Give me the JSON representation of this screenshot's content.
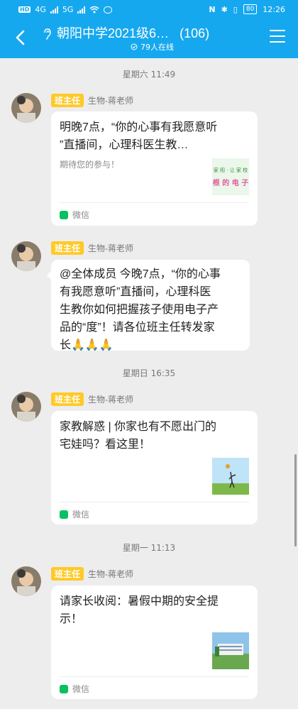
{
  "status_bar": {
    "network1": "4G",
    "network2": "5G",
    "battery": "80",
    "time": "12:26"
  },
  "header": {
    "title": "朝阳中学2021级6…",
    "member_count": "(106)",
    "online": "79人在线"
  },
  "messages": [
    {
      "timestamp": "星期六 11:49",
      "role": "班主任",
      "sender": "生物-蒋老师",
      "type": "card",
      "title_line1": "明晚7点，“你的心事有我愿意听",
      "title_line2": "”直播间，心理科医生教…",
      "desc": "期待您的参与！",
      "source": "微信",
      "thumb_text_top": "家 阳 · 让 家 校",
      "thumb_text_bottom": "根 的 电 子"
    },
    {
      "role": "班主任",
      "sender": "生物-蒋老师",
      "type": "text",
      "lines": [
        "@全体成员 今晚7点，“你的心事",
        "有我愿意听”直播间，心理科医",
        "生教你如何把握孩子使用电子产",
        "品的“度”！请各位班主任转发家",
        "长🙏🙏🙏"
      ]
    },
    {
      "timestamp": "星期日 16:35",
      "role": "班主任",
      "sender": "生物-蒋老师",
      "type": "card",
      "title_line1": "家教解惑 | 你家也有不愿出门的",
      "title_line2": "宅娃吗？看这里！",
      "source": "微信"
    },
    {
      "timestamp": "星期一 11:13",
      "role": "班主任",
      "sender": "生物-蒋老师",
      "type": "card",
      "title_line1": "请家长收阅：暑假中期的安全提",
      "title_line2": "示！",
      "source": "微信"
    }
  ],
  "colors": {
    "header": "#16a8ef",
    "badge": "#ffc928",
    "background": "#ededed"
  }
}
